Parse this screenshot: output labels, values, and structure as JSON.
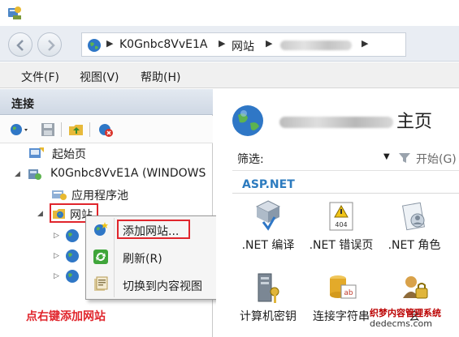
{
  "navigation": {
    "breadcrumb": [
      "K0Gnbc8VvE1A",
      "网站"
    ],
    "separator": "▶"
  },
  "menu": {
    "items": [
      "文件(F)",
      "视图(V)",
      "帮助(H)"
    ]
  },
  "connections": {
    "header": "连接",
    "tree": {
      "start_page": "起始页",
      "server": "K0Gnbc8VvE1A (WINDOWS",
      "app_pools": "应用程序池",
      "sites": "网站"
    }
  },
  "context_menu": {
    "items": [
      "添加网站...",
      "刷新(R)",
      "切换到内容视图"
    ]
  },
  "annotation": {
    "hint": "点右键添加网站"
  },
  "main": {
    "title_suffix": "主页",
    "filter_label": "筛选:",
    "start_button": "开始(G)",
    "section": "ASP.NET",
    "features": [
      ".NET 编译",
      ".NET 错误页",
      ".NET 角色",
      "计算机密钥",
      "连接字符串"
    ],
    "feature_partial": "会"
  },
  "watermark": {
    "line1": "织梦内容管理系统",
    "line2": "dedecms.com"
  }
}
